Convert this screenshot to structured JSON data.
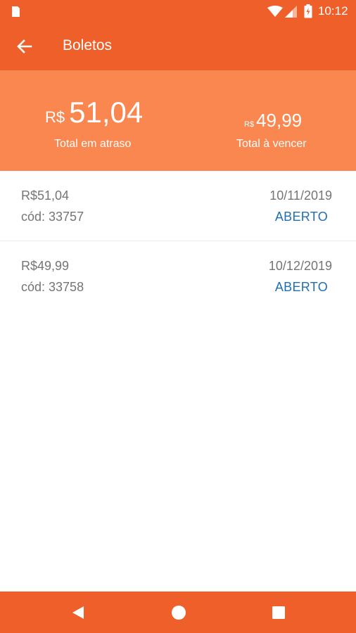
{
  "status_bar": {
    "time": "10:12",
    "icons": [
      "sim-card-icon",
      "wifi-icon",
      "cellular-signal-icon",
      "battery-icon"
    ]
  },
  "app_bar": {
    "title": "Boletos",
    "back_icon": "arrow-left-icon"
  },
  "summary": {
    "overdue": {
      "currency": "R$",
      "value": "51,04",
      "label": "Total em atraso"
    },
    "due": {
      "currency": "R$",
      "value": "49,99",
      "label": "Total à vencer"
    }
  },
  "boletos": [
    {
      "price": "R$51,04",
      "code": "cód: 33757",
      "date": "10/11/2019",
      "status": "ABERTO"
    },
    {
      "price": "R$49,99",
      "code": "cód: 33758",
      "date": "10/12/2019",
      "status": "ABERTO"
    }
  ],
  "nav_bar": {
    "icons": [
      "nav-back-icon",
      "nav-home-icon",
      "nav-recents-icon"
    ]
  },
  "colors": {
    "primary": "#ee5f2a",
    "summary_bg": "#f9874f",
    "status_blue": "#1f6fb4",
    "text_gray": "#757575"
  }
}
